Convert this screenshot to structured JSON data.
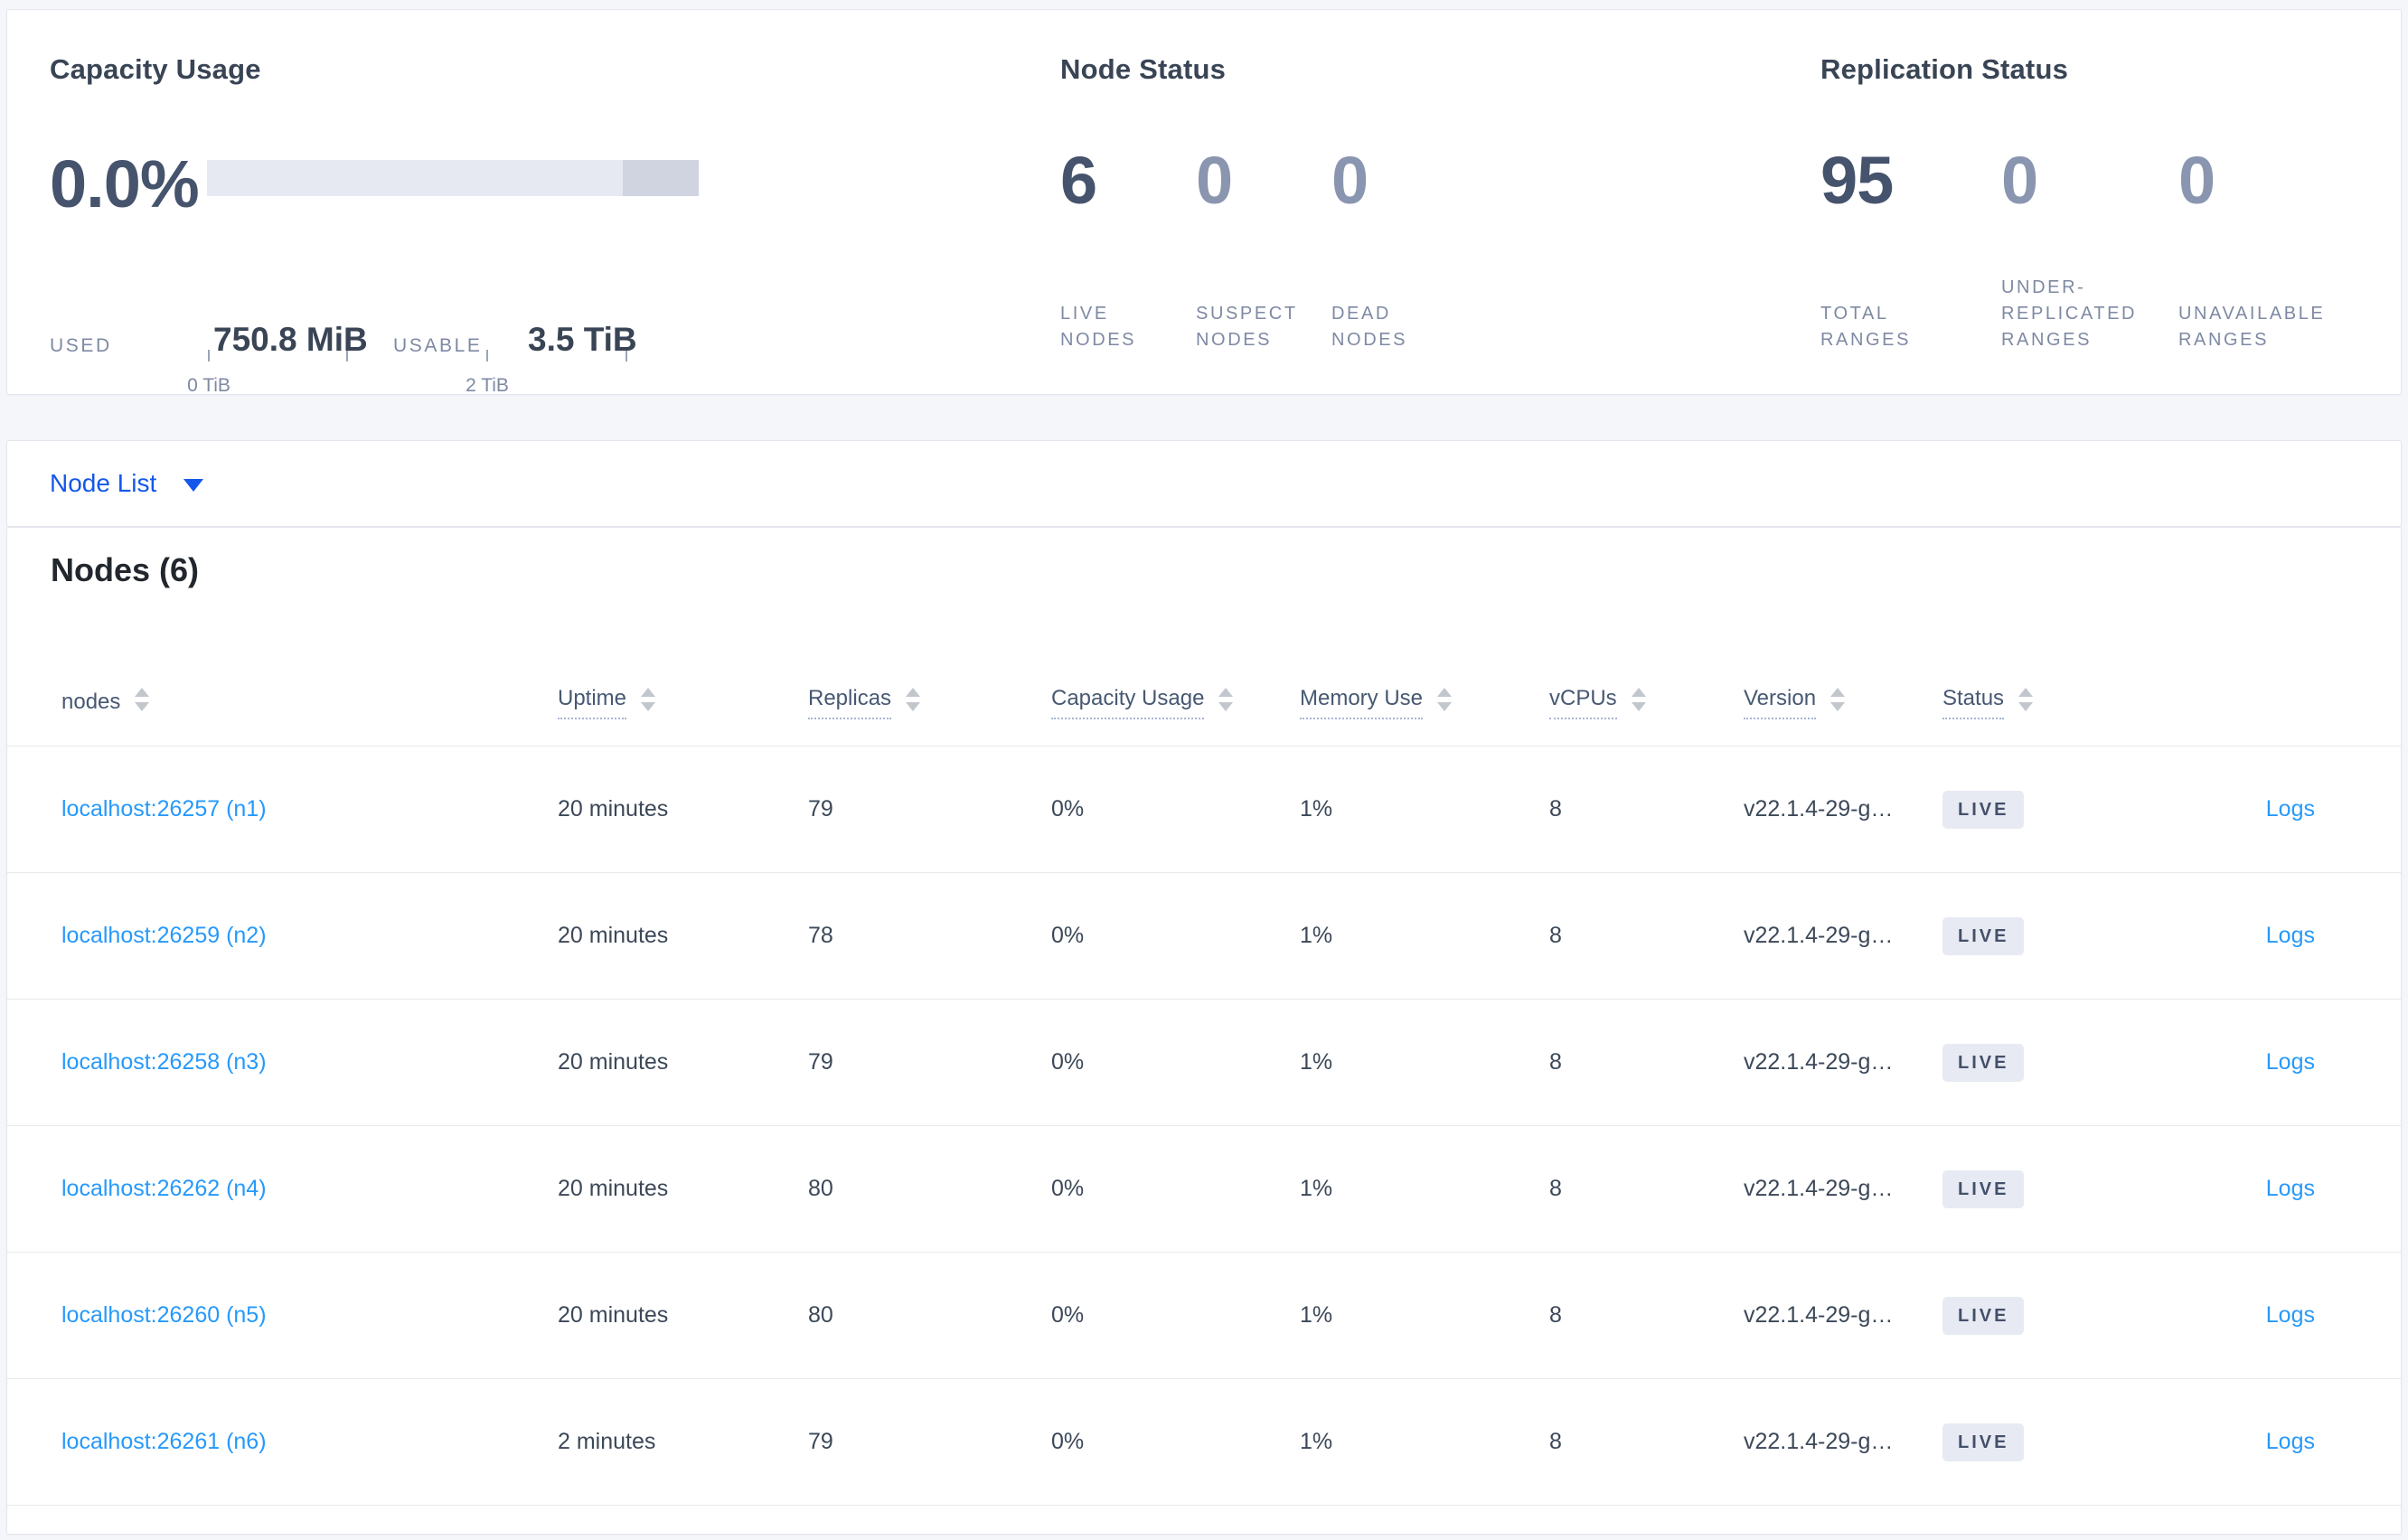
{
  "colors": {
    "page_bg": "#f5f6fa",
    "card_border": "#e3e6ec",
    "heading": "#22272e",
    "dark_text": "#394455",
    "number": "#46536d",
    "zero": "#8a95b0",
    "muted": "#7e89a3",
    "link": "#2699fb",
    "primary_blue": "#1457eb",
    "badge_bg": "#e7eaf2",
    "badge_text": "#44506a",
    "bar_light": "#e7e9f2",
    "bar_dark": "#d0d4e0",
    "row_border": "#e7e9ed",
    "dotted": "#a6b4d4",
    "sort": "#c2c6cd",
    "tick": "#9aa5b8"
  },
  "icons": {
    "sort": "sort-arrows",
    "caret": "caret-down-icon"
  },
  "summary": {
    "capacity": {
      "title": "Capacity Usage",
      "percent": "0.0%",
      "axis_ticks": [
        "0 TiB",
        "2 TiB"
      ],
      "used_label": "USED",
      "used_value": "750.8 MiB",
      "usable_label": "USABLE",
      "usable_value": "3.5 TiB",
      "chart": {
        "type": "bar",
        "used_fraction": 0.0,
        "usable_tib": 3.5,
        "tick_interval_tib": 1,
        "highlight_from_fraction": 0.846
      }
    },
    "node_status": {
      "title": "Node Status",
      "metrics": [
        {
          "value": "6",
          "label": "LIVE NODES"
        },
        {
          "value": "0",
          "label": "SUSPECT NODES"
        },
        {
          "value": "0",
          "label": "DEAD NODES"
        }
      ]
    },
    "replication": {
      "title": "Replication Status",
      "metrics": [
        {
          "value": "95",
          "label": "TOTAL RANGES"
        },
        {
          "value": "0",
          "label": "UNDER-REPLICATED RANGES"
        },
        {
          "value": "0",
          "label": "UNAVAILABLE RANGES"
        }
      ]
    }
  },
  "node_list": {
    "label": "Node List"
  },
  "table": {
    "title": "Nodes (6)",
    "columns": [
      "nodes",
      "Uptime",
      "Replicas",
      "Capacity Usage",
      "Memory Use",
      "vCPUs",
      "Version",
      "Status"
    ],
    "rows": [
      {
        "node": "localhost:26257 (n1)",
        "uptime": "20 minutes",
        "replicas": "79",
        "capacity": "0%",
        "memory": "1%",
        "vcpus": "8",
        "version": "v22.1.4-29-g…",
        "status": "LIVE",
        "logs": "Logs"
      },
      {
        "node": "localhost:26259 (n2)",
        "uptime": "20 minutes",
        "replicas": "78",
        "capacity": "0%",
        "memory": "1%",
        "vcpus": "8",
        "version": "v22.1.4-29-g…",
        "status": "LIVE",
        "logs": "Logs"
      },
      {
        "node": "localhost:26258 (n3)",
        "uptime": "20 minutes",
        "replicas": "79",
        "capacity": "0%",
        "memory": "1%",
        "vcpus": "8",
        "version": "v22.1.4-29-g…",
        "status": "LIVE",
        "logs": "Logs"
      },
      {
        "node": "localhost:26262 (n4)",
        "uptime": "20 minutes",
        "replicas": "80",
        "capacity": "0%",
        "memory": "1%",
        "vcpus": "8",
        "version": "v22.1.4-29-g…",
        "status": "LIVE",
        "logs": "Logs"
      },
      {
        "node": "localhost:26260 (n5)",
        "uptime": "20 minutes",
        "replicas": "80",
        "capacity": "0%",
        "memory": "1%",
        "vcpus": "8",
        "version": "v22.1.4-29-g…",
        "status": "LIVE",
        "logs": "Logs"
      },
      {
        "node": "localhost:26261 (n6)",
        "uptime": "2 minutes",
        "replicas": "79",
        "capacity": "0%",
        "memory": "1%",
        "vcpus": "8",
        "version": "v22.1.4-29-g…",
        "status": "LIVE",
        "logs": "Logs"
      }
    ]
  }
}
